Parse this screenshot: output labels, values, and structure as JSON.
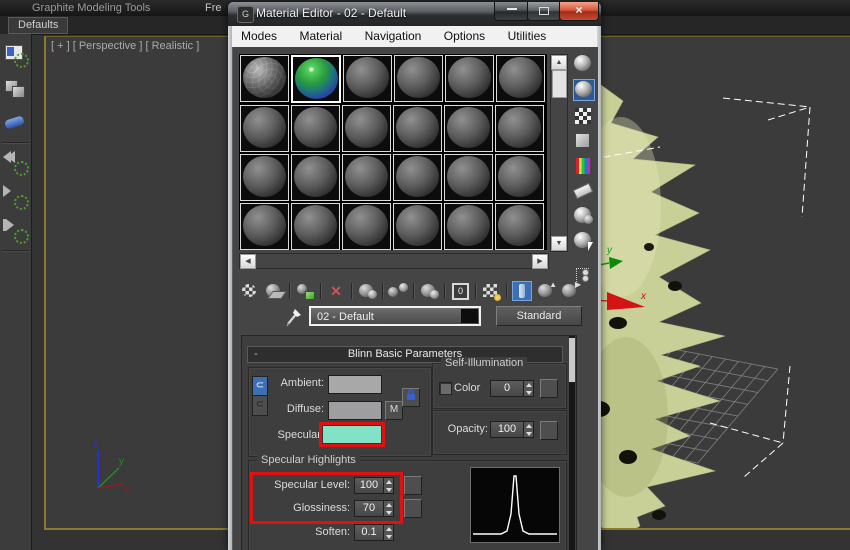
{
  "glyphs": {
    "up_arrow": "▲",
    "down_arrow": "▼",
    "left_arrow": "◀",
    "right_arrow": "▶",
    "close": "×",
    "collapse_minus": "-",
    "reset_x": "✕",
    "material_id_zero": "0",
    "lock_bracket": "⊂",
    "go_parent_arrow": "▲",
    "go_sibling_arrow": "▶",
    "play": "▷"
  },
  "app": {
    "ribbon_tab_graphite": "Graphite Modeling Tools",
    "ribbon_tab_freeform_partial": "Fre",
    "defaults_tab": "Defaults",
    "viewport_label": "[ + ] [ Perspective ] [ Realistic ]",
    "axis_tripod": {
      "x": "x",
      "y": "y",
      "z": "z"
    },
    "gizmo_labels": {
      "x": "x",
      "y": "y"
    }
  },
  "material_editor": {
    "title": "Material Editor - 02 - Default",
    "menus": [
      "Modes",
      "Material",
      "Navigation",
      "Options",
      "Utilities"
    ],
    "material_name": "02 - Default",
    "type_button_label": "Standard",
    "map_button_label": "M",
    "rollout_title": "Blinn Basic Parameters",
    "params": {
      "ambient_label": "Ambient:",
      "diffuse_label": "Diffuse:",
      "specular_label": "Specular:",
      "self_illumination_title": "Self-Illumination",
      "color_label": "Color",
      "self_illumination_value": "0",
      "opacity_label": "Opacity:",
      "opacity_value": "100",
      "specular_highlights_title": "Specular Highlights",
      "specular_level_label": "Specular Level:",
      "specular_level_value": "100",
      "glossiness_label": "Glossiness:",
      "glossiness_value": "70",
      "soften_label": "Soften:",
      "soften_value": "0.1"
    },
    "colors": {
      "specular_swatch": "#82e2c6",
      "ambient_swatch": "#a8a8a8",
      "diffuse_swatch": "#9e9ea0",
      "highlight_box": "#de1212",
      "viewport_border": "#8a7a30",
      "object_base": "#c9d097"
    }
  }
}
